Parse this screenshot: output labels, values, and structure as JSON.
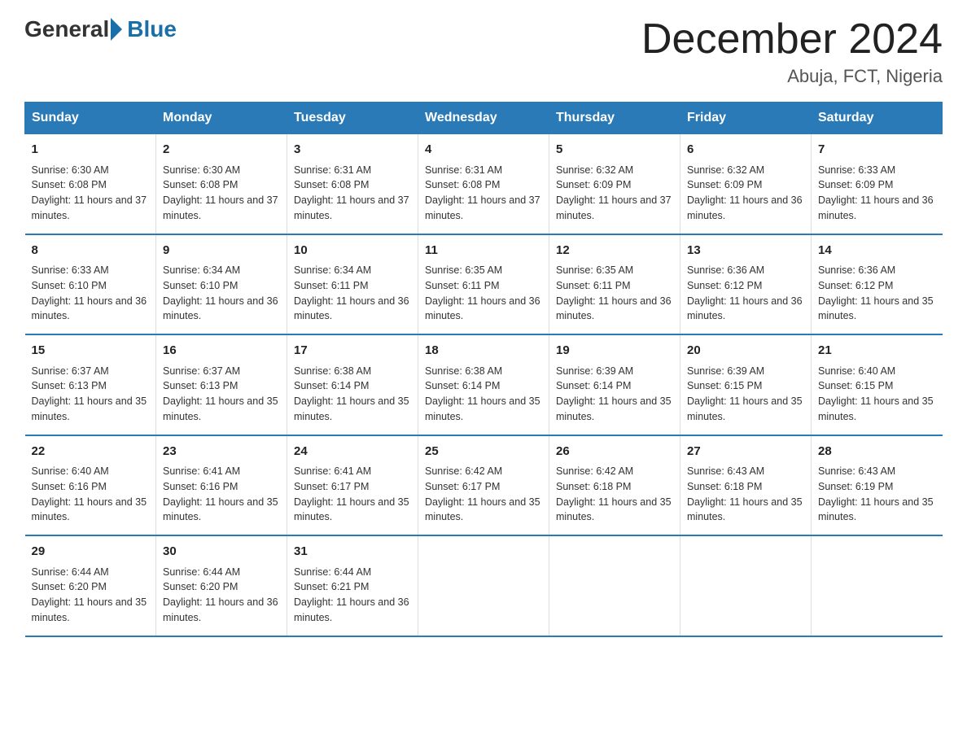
{
  "logo": {
    "text_general": "General",
    "text_blue": "Blue"
  },
  "title": "December 2024",
  "subtitle": "Abuja, FCT, Nigeria",
  "days_of_week": [
    "Sunday",
    "Monday",
    "Tuesday",
    "Wednesday",
    "Thursday",
    "Friday",
    "Saturday"
  ],
  "weeks": [
    [
      {
        "day": "1",
        "sunrise": "6:30 AM",
        "sunset": "6:08 PM",
        "daylight": "11 hours and 37 minutes."
      },
      {
        "day": "2",
        "sunrise": "6:30 AM",
        "sunset": "6:08 PM",
        "daylight": "11 hours and 37 minutes."
      },
      {
        "day": "3",
        "sunrise": "6:31 AM",
        "sunset": "6:08 PM",
        "daylight": "11 hours and 37 minutes."
      },
      {
        "day": "4",
        "sunrise": "6:31 AM",
        "sunset": "6:08 PM",
        "daylight": "11 hours and 37 minutes."
      },
      {
        "day": "5",
        "sunrise": "6:32 AM",
        "sunset": "6:09 PM",
        "daylight": "11 hours and 37 minutes."
      },
      {
        "day": "6",
        "sunrise": "6:32 AM",
        "sunset": "6:09 PM",
        "daylight": "11 hours and 36 minutes."
      },
      {
        "day": "7",
        "sunrise": "6:33 AM",
        "sunset": "6:09 PM",
        "daylight": "11 hours and 36 minutes."
      }
    ],
    [
      {
        "day": "8",
        "sunrise": "6:33 AM",
        "sunset": "6:10 PM",
        "daylight": "11 hours and 36 minutes."
      },
      {
        "day": "9",
        "sunrise": "6:34 AM",
        "sunset": "6:10 PM",
        "daylight": "11 hours and 36 minutes."
      },
      {
        "day": "10",
        "sunrise": "6:34 AM",
        "sunset": "6:11 PM",
        "daylight": "11 hours and 36 minutes."
      },
      {
        "day": "11",
        "sunrise": "6:35 AM",
        "sunset": "6:11 PM",
        "daylight": "11 hours and 36 minutes."
      },
      {
        "day": "12",
        "sunrise": "6:35 AM",
        "sunset": "6:11 PM",
        "daylight": "11 hours and 36 minutes."
      },
      {
        "day": "13",
        "sunrise": "6:36 AM",
        "sunset": "6:12 PM",
        "daylight": "11 hours and 36 minutes."
      },
      {
        "day": "14",
        "sunrise": "6:36 AM",
        "sunset": "6:12 PM",
        "daylight": "11 hours and 35 minutes."
      }
    ],
    [
      {
        "day": "15",
        "sunrise": "6:37 AM",
        "sunset": "6:13 PM",
        "daylight": "11 hours and 35 minutes."
      },
      {
        "day": "16",
        "sunrise": "6:37 AM",
        "sunset": "6:13 PM",
        "daylight": "11 hours and 35 minutes."
      },
      {
        "day": "17",
        "sunrise": "6:38 AM",
        "sunset": "6:14 PM",
        "daylight": "11 hours and 35 minutes."
      },
      {
        "day": "18",
        "sunrise": "6:38 AM",
        "sunset": "6:14 PM",
        "daylight": "11 hours and 35 minutes."
      },
      {
        "day": "19",
        "sunrise": "6:39 AM",
        "sunset": "6:14 PM",
        "daylight": "11 hours and 35 minutes."
      },
      {
        "day": "20",
        "sunrise": "6:39 AM",
        "sunset": "6:15 PM",
        "daylight": "11 hours and 35 minutes."
      },
      {
        "day": "21",
        "sunrise": "6:40 AM",
        "sunset": "6:15 PM",
        "daylight": "11 hours and 35 minutes."
      }
    ],
    [
      {
        "day": "22",
        "sunrise": "6:40 AM",
        "sunset": "6:16 PM",
        "daylight": "11 hours and 35 minutes."
      },
      {
        "day": "23",
        "sunrise": "6:41 AM",
        "sunset": "6:16 PM",
        "daylight": "11 hours and 35 minutes."
      },
      {
        "day": "24",
        "sunrise": "6:41 AM",
        "sunset": "6:17 PM",
        "daylight": "11 hours and 35 minutes."
      },
      {
        "day": "25",
        "sunrise": "6:42 AM",
        "sunset": "6:17 PM",
        "daylight": "11 hours and 35 minutes."
      },
      {
        "day": "26",
        "sunrise": "6:42 AM",
        "sunset": "6:18 PM",
        "daylight": "11 hours and 35 minutes."
      },
      {
        "day": "27",
        "sunrise": "6:43 AM",
        "sunset": "6:18 PM",
        "daylight": "11 hours and 35 minutes."
      },
      {
        "day": "28",
        "sunrise": "6:43 AM",
        "sunset": "6:19 PM",
        "daylight": "11 hours and 35 minutes."
      }
    ],
    [
      {
        "day": "29",
        "sunrise": "6:44 AM",
        "sunset": "6:20 PM",
        "daylight": "11 hours and 35 minutes."
      },
      {
        "day": "30",
        "sunrise": "6:44 AM",
        "sunset": "6:20 PM",
        "daylight": "11 hours and 36 minutes."
      },
      {
        "day": "31",
        "sunrise": "6:44 AM",
        "sunset": "6:21 PM",
        "daylight": "11 hours and 36 minutes."
      },
      null,
      null,
      null,
      null
    ]
  ]
}
